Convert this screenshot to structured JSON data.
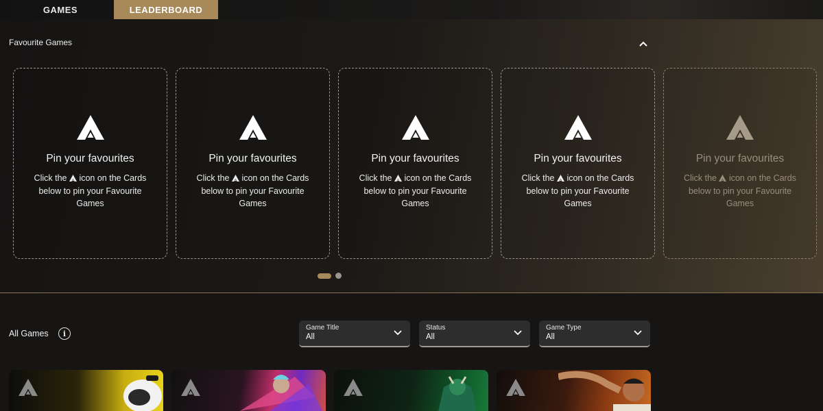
{
  "tabs": {
    "games": "GAMES",
    "leaderboard": "LEADERBOARD"
  },
  "favourites": {
    "title": "Favourite Games",
    "cards": [
      {
        "title": "Pin your favourites",
        "desc_before": "Click the",
        "desc_after": "icon on the Cards below to pin your Favourite Games"
      },
      {
        "title": "Pin your favourites",
        "desc_before": "Click the",
        "desc_after": "icon on the Cards below to pin your Favourite Games"
      },
      {
        "title": "Pin your favourites",
        "desc_before": "Click the",
        "desc_after": "icon on the Cards below to pin your Favourite Games"
      },
      {
        "title": "Pin your favourites",
        "desc_before": "Click the",
        "desc_after": "icon on the Cards below to pin your Favourite Games"
      },
      {
        "title": "Pin your favourites",
        "desc_before": "Click the",
        "desc_after": "icon on the Cards below to pin your Favourite Games"
      }
    ],
    "pagination": {
      "pages": 2,
      "current": 1
    }
  },
  "all_games": {
    "title": "All Games",
    "filters": [
      {
        "label": "Game Title",
        "value": "All"
      },
      {
        "label": "Status",
        "value": "All"
      },
      {
        "label": "Game Type",
        "value": "All"
      }
    ]
  },
  "colors": {
    "accent": "#a7895a",
    "background": "#161514",
    "filter_bg": "#2d2d2e"
  },
  "icons": [
    "chevron-up-icon",
    "pin-logo-icon",
    "info-icon",
    "chevron-down-icon"
  ]
}
